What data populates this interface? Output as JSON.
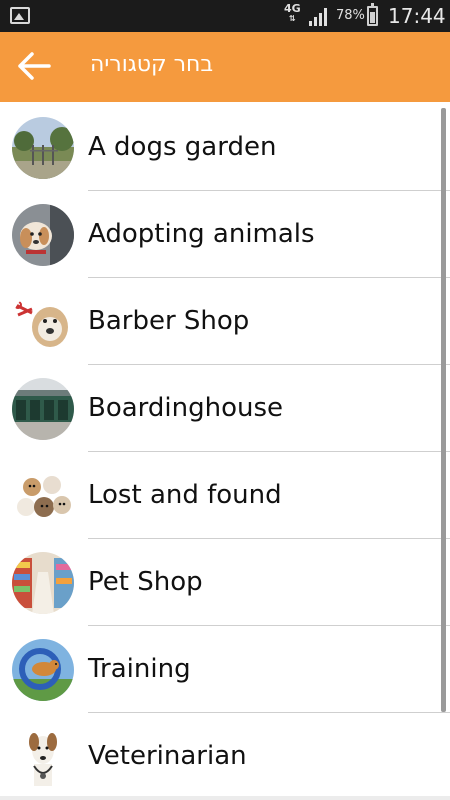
{
  "status_bar": {
    "network_type": "4G",
    "battery_level": 0.78,
    "battery_percent": "78%",
    "time": "17:44",
    "icons": [
      "gallery-icon",
      "signal-icon",
      "battery-icon"
    ]
  },
  "app_bar": {
    "title": "בחר קטגוריה",
    "back_icon": "arrow-left-icon",
    "color": "#f59a3e"
  },
  "categories": [
    {
      "label": "A dogs garden",
      "avatar": "dog-park-photo"
    },
    {
      "label": "Adopting animals",
      "avatar": "puppy-photo"
    },
    {
      "label": "Barber Shop",
      "avatar": "bulldog-grooming-photo"
    },
    {
      "label": "Boardinghouse",
      "avatar": "kennels-photo"
    },
    {
      "label": "Lost and found",
      "avatar": "group-of-dogs-photo"
    },
    {
      "label": "Pet Shop",
      "avatar": "pet-store-aisle-photo"
    },
    {
      "label": "Training",
      "avatar": "agility-training-photo"
    },
    {
      "label": "Veterinarian",
      "avatar": "dog-with-stethoscope-photo"
    }
  ]
}
